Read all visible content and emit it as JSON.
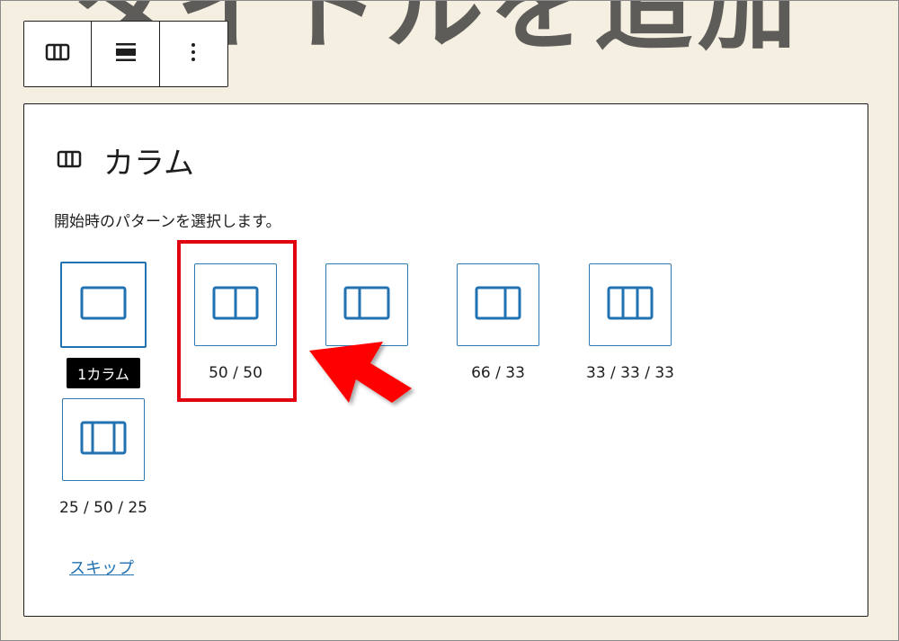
{
  "background": {
    "title": "タイトルを追加"
  },
  "toolbar": {
    "buttons": [
      {
        "name": "block-type-button",
        "icon": "columns-icon"
      },
      {
        "name": "align-button",
        "icon": "align-wide-icon"
      },
      {
        "name": "more-options-button",
        "icon": "more-vertical-icon"
      }
    ]
  },
  "panel": {
    "title": "カラム",
    "instructions": "開始時のパターンを選択します。",
    "variations": [
      {
        "id": "100",
        "label": "",
        "tooltip": "1カラム"
      },
      {
        "id": "50-50",
        "label": "50 / 50"
      },
      {
        "id": "33-66",
        "label": ""
      },
      {
        "id": "66-33",
        "label": "66 / 33"
      },
      {
        "id": "33-33-33",
        "label": "33 / 33 / 33"
      },
      {
        "id": "25-50-25",
        "label": "25 / 50 / 25"
      }
    ],
    "skip_label": "スキップ"
  },
  "colors": {
    "accent": "#2271b1",
    "highlight": "#e1000f",
    "background": "#f4efe1"
  }
}
